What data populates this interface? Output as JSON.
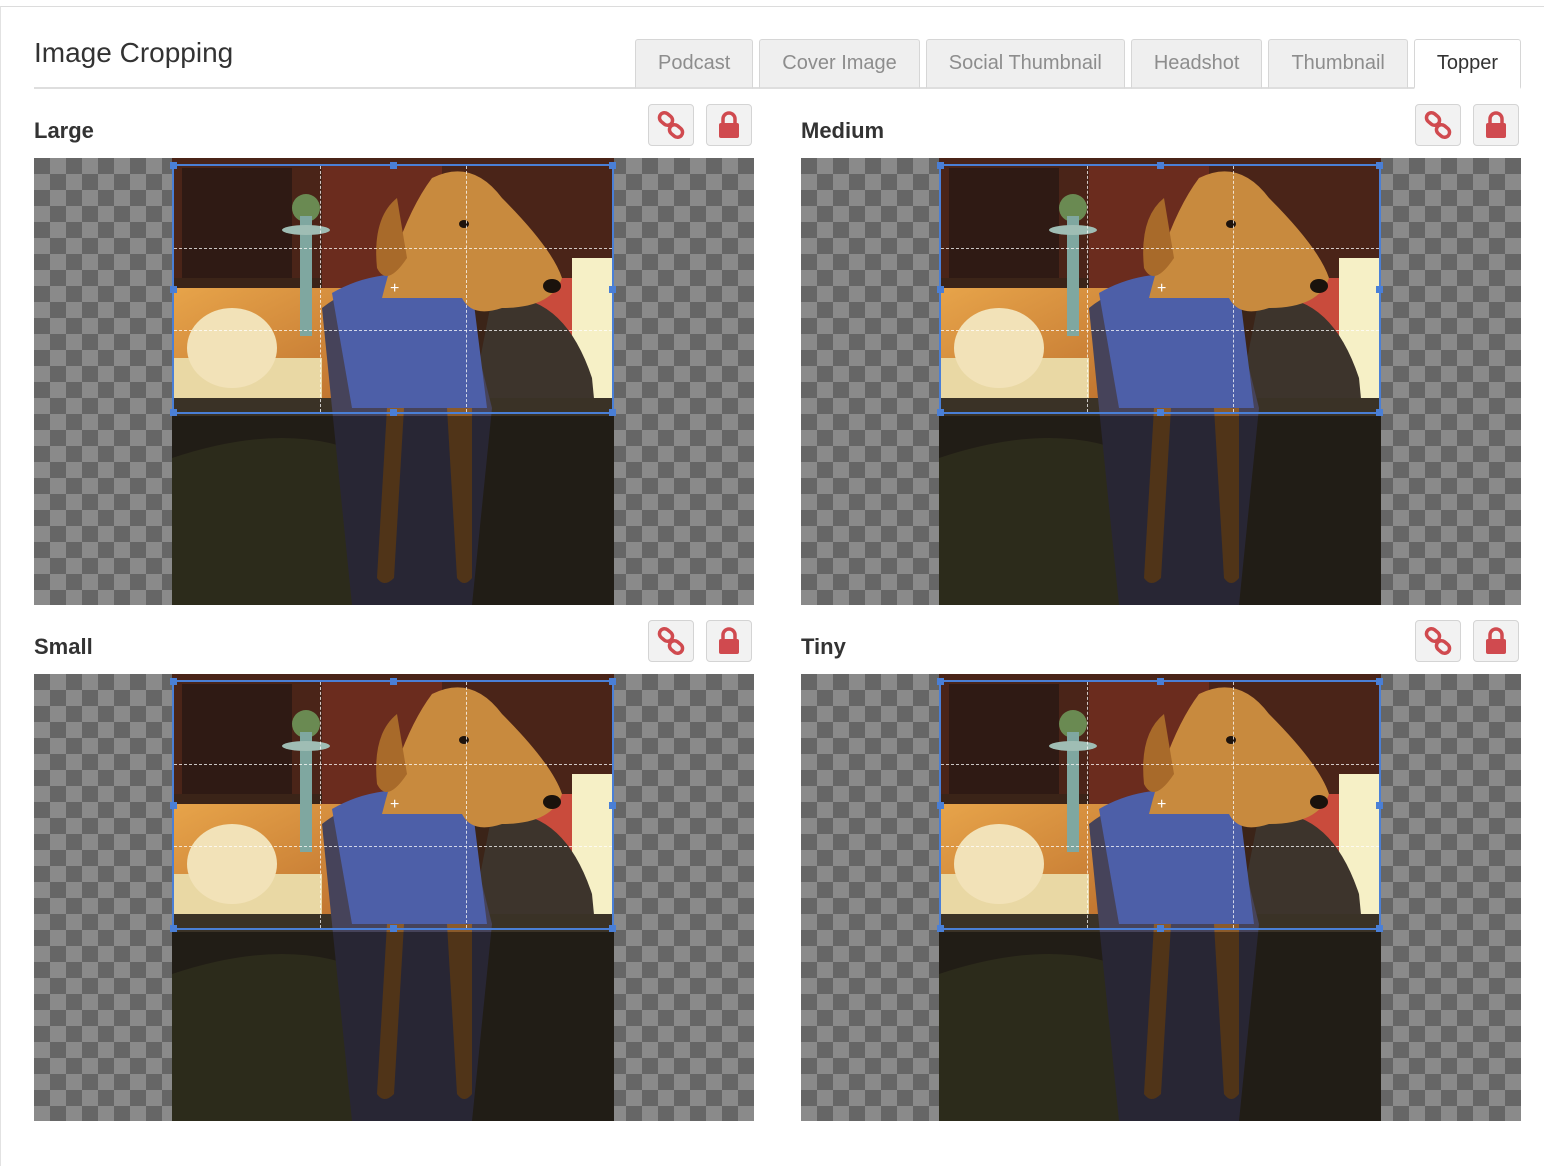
{
  "header": {
    "title": "Image Cropping"
  },
  "tabs": [
    {
      "label": "Podcast",
      "active": false
    },
    {
      "label": "Cover Image",
      "active": false
    },
    {
      "label": "Social Thumbnail",
      "active": false
    },
    {
      "label": "Headshot",
      "active": false
    },
    {
      "label": "Thumbnail",
      "active": false
    },
    {
      "label": "Topper",
      "active": true
    }
  ],
  "croppers": [
    {
      "label": "Large"
    },
    {
      "label": "Medium"
    },
    {
      "label": "Small"
    },
    {
      "label": "Tiny"
    }
  ],
  "icons": {
    "link": "link-icon",
    "lock": "lock-icon"
  },
  "colors": {
    "accent": "#4a7fd6",
    "icon_red": "#d04a4f"
  }
}
